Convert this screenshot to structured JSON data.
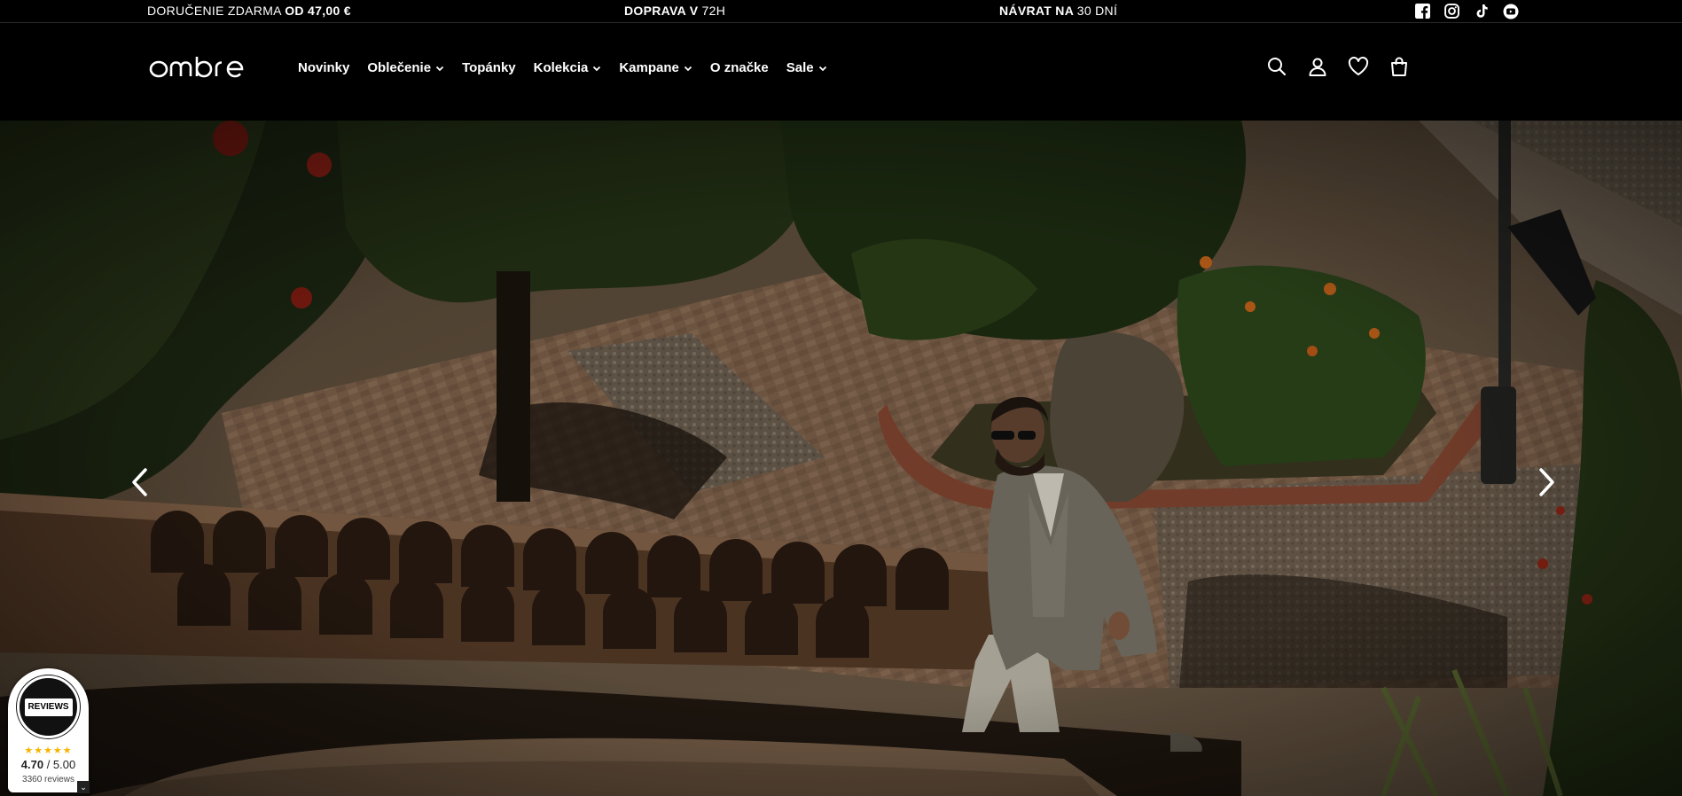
{
  "announcements": [
    {
      "text": "DORUČENIE ZDARMA ",
      "bold": "OD 47,00 €"
    },
    {
      "bold": "DOPRAVA V ",
      "text": "72H"
    },
    {
      "bold": "NÁVRAT NA ",
      "text": "30 DNÍ"
    }
  ],
  "social": [
    "facebook-icon",
    "instagram-icon",
    "tiktok-icon",
    "youtube-icon"
  ],
  "logo": "ombre",
  "nav": [
    {
      "label": "Novinky",
      "dropdown": false
    },
    {
      "label": "Oblečenie",
      "dropdown": true
    },
    {
      "label": "Topánky",
      "dropdown": false
    },
    {
      "label": "Kolekcia",
      "dropdown": true
    },
    {
      "label": "Kampane",
      "dropdown": true
    },
    {
      "label": "O značke",
      "dropdown": false
    },
    {
      "label": "Sale",
      "dropdown": true
    }
  ],
  "header_icons": [
    "search-icon",
    "account-icon",
    "wishlist-icon",
    "cart-icon"
  ],
  "badge": {
    "seal_text": "REVIEWS",
    "rating": "4.70",
    "rating_max": " / 5.00",
    "count": "3360 reviews",
    "stars": "★★★★★",
    "corner_icon": "chevron-down-icon",
    "corner": "⌄"
  },
  "colors": {
    "background": "#000000",
    "text": "#ffffff",
    "star": "#f5b400"
  }
}
